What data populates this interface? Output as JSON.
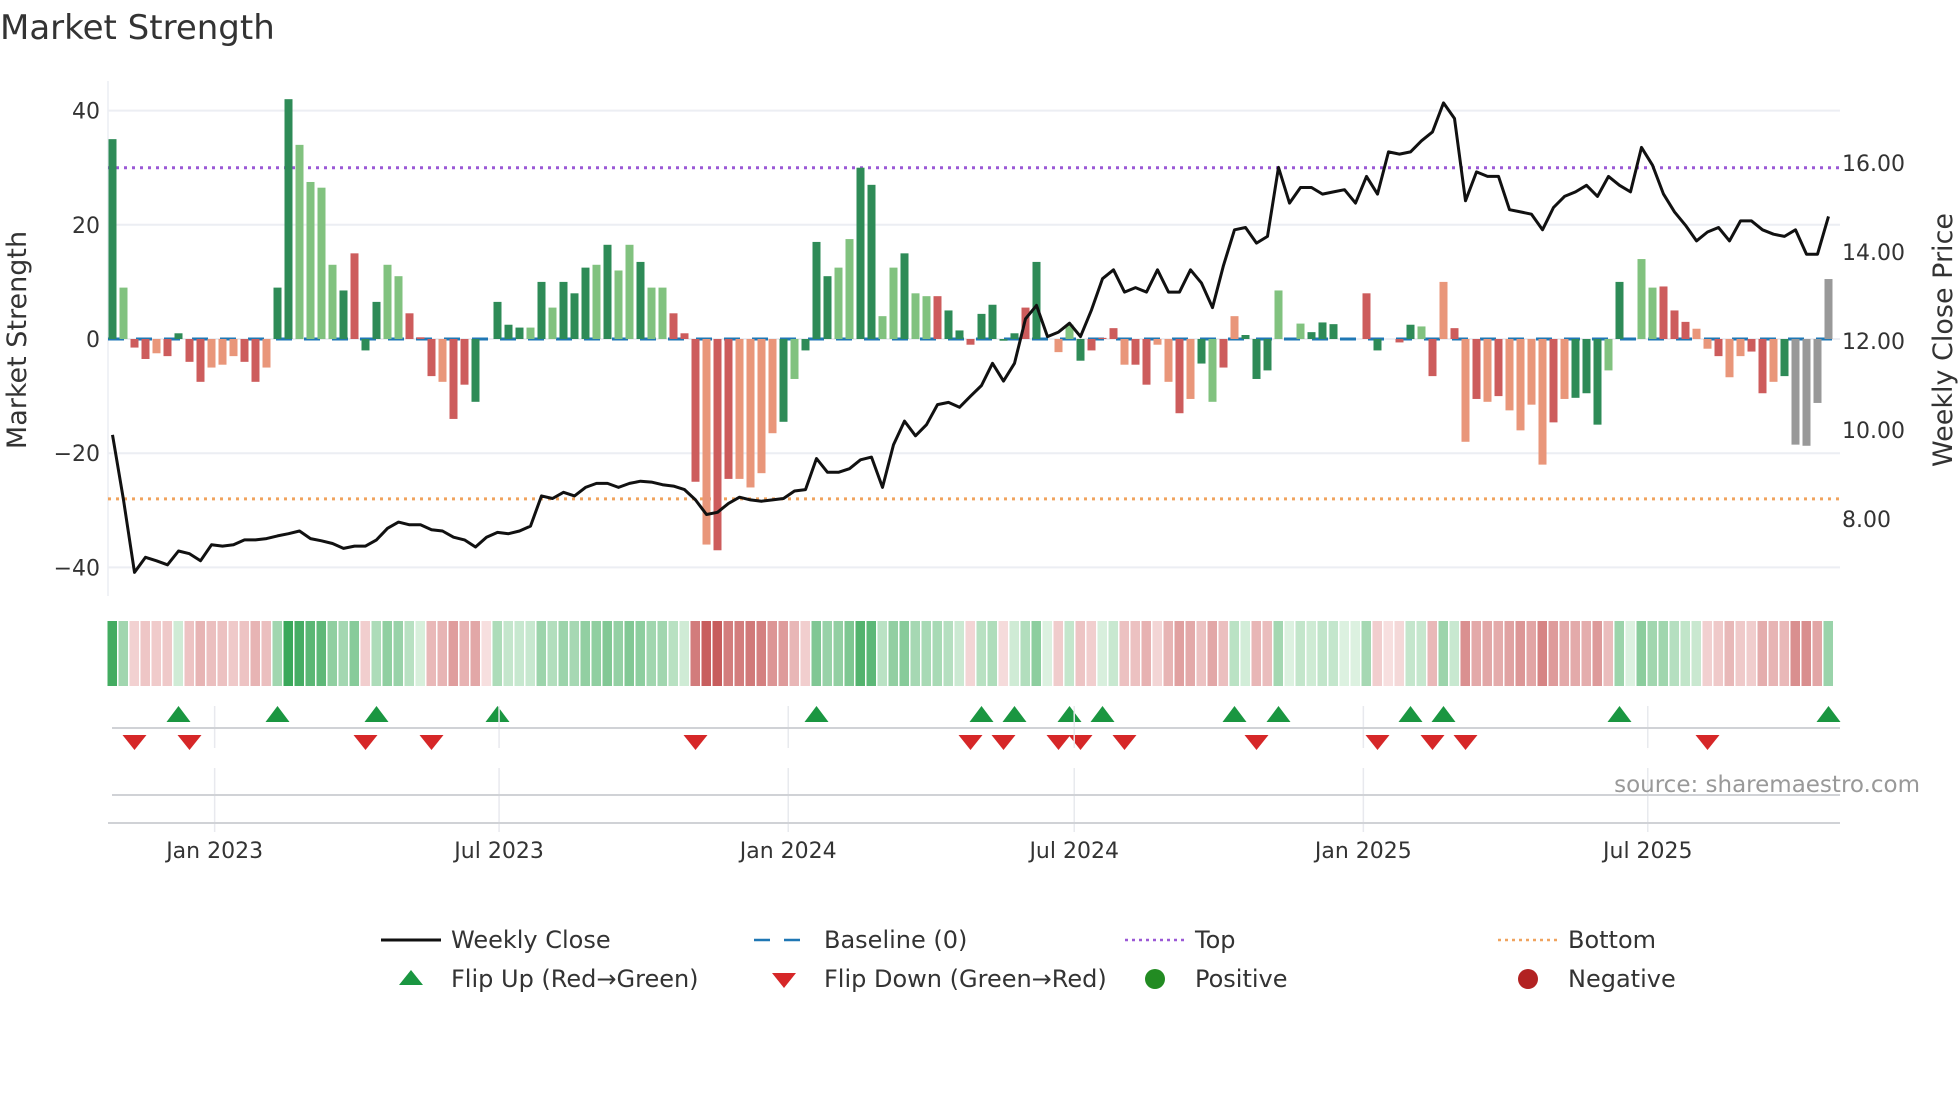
{
  "chart_data": {
    "type": "bar",
    "title": "Market Strength",
    "ylabel": "Market Strength",
    "y2label": "Weekly Close Price",
    "ylim": [
      -44,
      46
    ],
    "y2lim": [
      6.35,
      17.7
    ],
    "yticks": [
      "40",
      "20",
      "0",
      "−20",
      "−40"
    ],
    "ytick_values": [
      40,
      20,
      0,
      -20,
      -40
    ],
    "y2ticks": [
      "16.00",
      "14.00",
      "12.00",
      "10.00",
      "8.00"
    ],
    "y2tick_values": [
      16,
      14,
      12,
      10,
      8
    ],
    "xticks": [
      "Jan 2023",
      "Jul 2023",
      "Jan 2024",
      "Jul 2024",
      "Jan 2025",
      "Jul 2025"
    ],
    "xtick_dates": [
      "2023-01-01",
      "2023-07-01",
      "2024-01-01",
      "2024-07-01",
      "2025-01-01",
      "2025-07-01"
    ],
    "start_date": "2022-10-28",
    "frequency": "weekly",
    "top_level": 30,
    "bottom_level": -28,
    "baseline": 0,
    "strength": [
      35,
      9,
      -1.5,
      -3.5,
      -2.5,
      -3,
      1,
      -4,
      -7.5,
      -5,
      -4.5,
      -3,
      -4,
      -7.5,
      -5,
      9,
      42,
      34,
      27.5,
      26.5,
      13,
      8.5,
      15,
      -2,
      6.5,
      13,
      11,
      4.5,
      0.3,
      -6.5,
      -7.5,
      -14,
      -8,
      -11,
      0,
      6.5,
      2.5,
      2,
      2,
      10,
      5.5,
      10,
      8,
      12.5,
      13,
      16.5,
      12,
      16.5,
      13.5,
      9,
      9,
      4.5,
      1,
      -25,
      -36,
      -37,
      -24.5,
      -24.5,
      -26,
      -23.5,
      -16.5,
      -14.5,
      -7,
      -2,
      17,
      11,
      12.5,
      17.5,
      30,
      27,
      4,
      12.5,
      15,
      8,
      7.5,
      7.5,
      5,
      1.5,
      -1,
      4.4,
      6,
      -0.3,
      1,
      5.5,
      13.5,
      0,
      -2.3,
      2.5,
      -3.8,
      -2,
      0.2,
      1.9,
      -4.5,
      -4.5,
      -8,
      -1,
      -7.5,
      -13,
      -10.5,
      -4.3,
      -11,
      -5,
      4,
      0.7,
      -7,
      -5.5,
      8.5,
      0,
      2.7,
      1.2,
      2.9,
      2.6,
      0,
      0,
      8,
      -2,
      0,
      -0.6,
      2.5,
      2.2,
      -6.5,
      10,
      1.9,
      -18,
      -10.5,
      -11,
      -10,
      -12.5,
      -16,
      -11.5,
      -22,
      -14.6,
      -10.5,
      -10.3,
      -9.5,
      -15,
      -5.5,
      10,
      0,
      14,
      9,
      9.2,
      5,
      3,
      1.8,
      -1.7,
      -3,
      -6.7,
      -3,
      -2.2,
      -9.5,
      -7.5,
      -6.5,
      -18.5,
      -18.7,
      -11.2,
      10.5
    ],
    "shade": "GgRRrRGRRrrrRRrGGggggGRGGggRRRrRRGgGGGgGgGGGgGggGggRRRrRRrrrrGgGGGggGGggGggRGGRGGGGRGRrgGRRRrRRrrRrGgRrGGGgGgGGGRRRGgRGgRrRrRrRrrrrRrGGGgGgggRRRrrRrrRRrG",
    "close": [
      9.89,
      8.43,
      6.8,
      7.14,
      7.06,
      6.97,
      7.28,
      7.22,
      7.06,
      7.42,
      7.39,
      7.42,
      7.53,
      7.53,
      7.56,
      7.62,
      7.67,
      7.73,
      7.56,
      7.51,
      7.45,
      7.34,
      7.39,
      7.39,
      7.53,
      7.79,
      7.93,
      7.87,
      7.87,
      7.76,
      7.73,
      7.59,
      7.53,
      7.37,
      7.59,
      7.7,
      7.67,
      7.73,
      7.84,
      8.52,
      8.46,
      8.6,
      8.52,
      8.71,
      8.8,
      8.8,
      8.71,
      8.8,
      8.85,
      8.83,
      8.77,
      8.74,
      8.66,
      8.43,
      8.1,
      8.15,
      8.35,
      8.49,
      8.43,
      8.4,
      8.43,
      8.46,
      8.63,
      8.66,
      9.36,
      9.05,
      9.05,
      9.13,
      9.33,
      9.39,
      8.71,
      9.67,
      10.2,
      9.87,
      10.12,
      10.57,
      10.62,
      10.51,
      10.76,
      11.0,
      11.5,
      11.1,
      11.5,
      12.5,
      12.8,
      12.1,
      12.2,
      12.4,
      12.1,
      12.7,
      13.4,
      13.6,
      13.1,
      13.2,
      13.1,
      13.6,
      13.1,
      13.1,
      13.6,
      13.3,
      12.75,
      13.7,
      14.5,
      14.55,
      14.2,
      14.35,
      15.9,
      15.1,
      15.45,
      15.45,
      15.3,
      15.35,
      15.4,
      15.1,
      15.7,
      15.3,
      16.25,
      16.2,
      16.25,
      16.5,
      16.7,
      17.35,
      17.0,
      15.15,
      15.8,
      15.7,
      15.7,
      14.95,
      14.9,
      14.85,
      14.5,
      15.0,
      15.25,
      15.35,
      15.5,
      15.25,
      15.7,
      15.5,
      15.35,
      16.35,
      15.95,
      15.3,
      14.9,
      14.6,
      14.25,
      14.45,
      14.55,
      14.25,
      14.7,
      14.7,
      14.5,
      14.4,
      14.35,
      14.5,
      13.95,
      13.95,
      14.8
    ],
    "flip_up_weeks": [
      6,
      15,
      24,
      35,
      64,
      79,
      82,
      87,
      90,
      102,
      106,
      118,
      121,
      137,
      156
    ],
    "flip_down_weeks": [
      2,
      7,
      23,
      29,
      53,
      78,
      81,
      86,
      88,
      92,
      104,
      115,
      120,
      123,
      145
    ],
    "legend": [
      {
        "label": "Weekly Close",
        "kind": "line",
        "color": "#111111"
      },
      {
        "label": "Baseline (0)",
        "kind": "dash",
        "color": "#1f77b4"
      },
      {
        "label": "Top",
        "kind": "dot",
        "color": "#9b59d6"
      },
      {
        "label": "Bottom",
        "kind": "dot",
        "color": "#f0a35e"
      },
      {
        "label": "Flip Up (Red→Green)",
        "kind": "up",
        "color": "#1a9641"
      },
      {
        "label": "Flip Down (Green→Red)",
        "kind": "down",
        "color": "#d62728"
      },
      {
        "label": "Positive",
        "kind": "circle",
        "color": "#228b22"
      },
      {
        "label": "Negative",
        "kind": "circle",
        "color": "#b22222"
      }
    ],
    "legend_placement": "bottom",
    "colors": {
      "strong_pos": "#2e8b57",
      "weak_pos": "#81c27f",
      "strong_neg": "#cd5c5c",
      "weak_neg": "#e9967a"
    }
  },
  "source": "source: sharemaestro.com"
}
